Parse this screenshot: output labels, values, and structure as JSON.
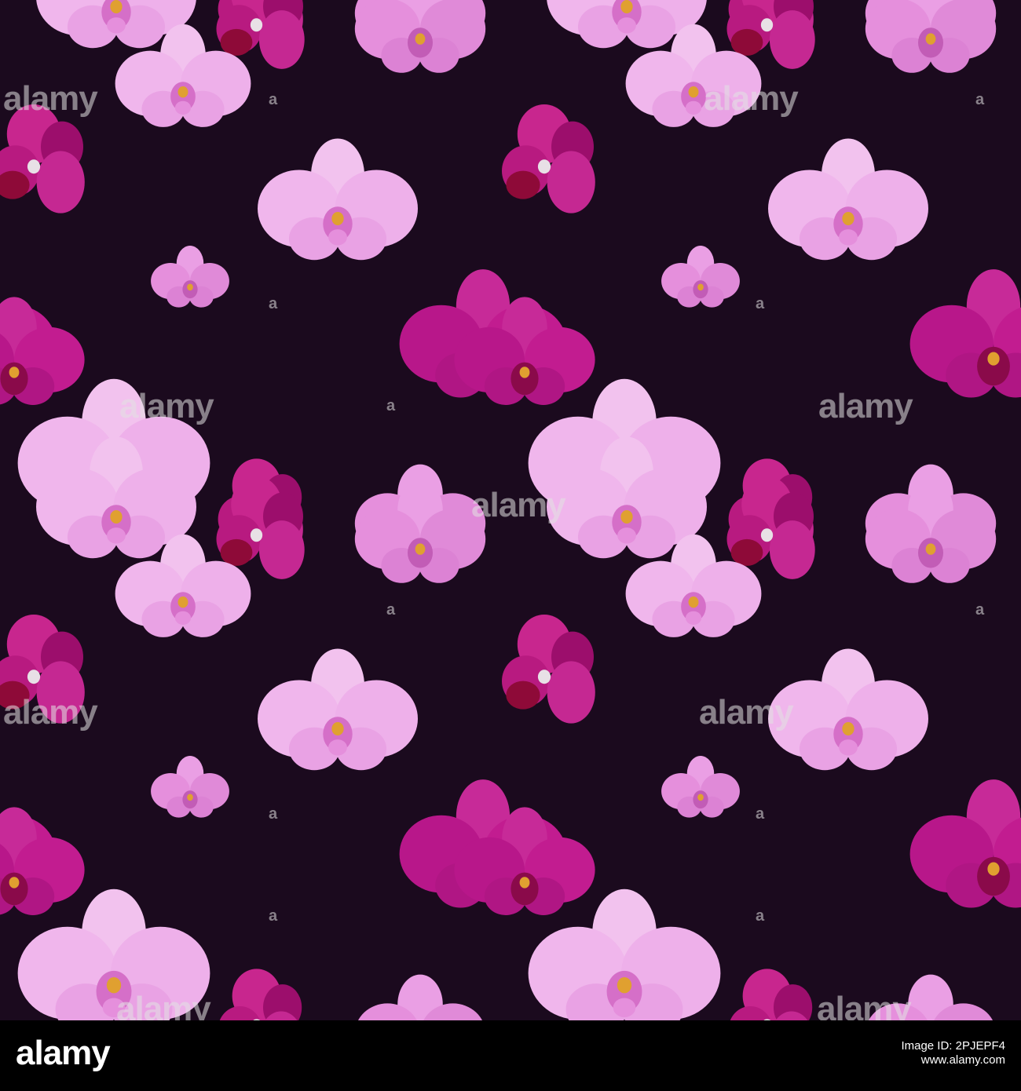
{
  "image": {
    "subject": "seamless orchid pattern",
    "background_color": "#1b0a1e",
    "palette": {
      "pale_pink": "#f0b6ec",
      "light_pink": "#e58fdc",
      "magenta": "#c21c90",
      "deep_magenta": "#9c0e6c",
      "center_yellow": "#e0a030"
    }
  },
  "watermark": {
    "text": "alamy"
  },
  "footer": {
    "logo": "alamy",
    "line1": "Image ID: 2PJEPF4",
    "line2": "www.alamy.com"
  }
}
